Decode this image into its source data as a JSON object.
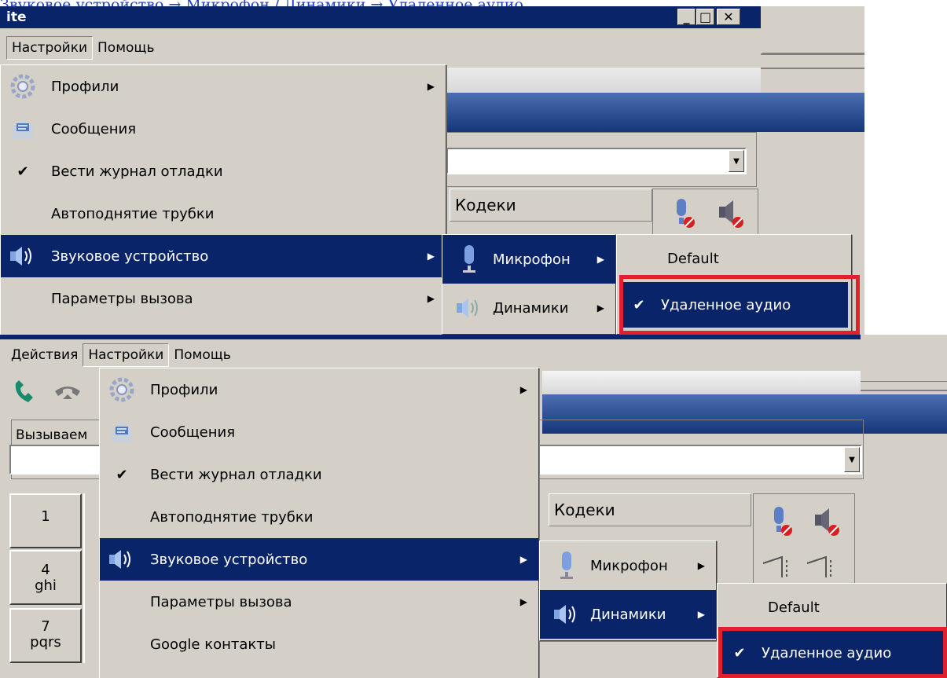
{
  "caption": "Звуковое устройство → Микрофон / Динамики → Удаленное аудио",
  "window": {
    "title": "ite",
    "buttons": [
      "_",
      "□",
      "✕"
    ]
  },
  "menubar_top": [
    "Настройки",
    "Помощь"
  ],
  "menubar_bottom": [
    "Действия",
    "Настройки",
    "Помощь"
  ],
  "settings_menu": {
    "items": [
      {
        "label": "Профили",
        "icon": "gear-icon",
        "submenu": true
      },
      {
        "label": "Сообщения",
        "icon": "message-icon",
        "submenu": false
      },
      {
        "label": "Вести журнал отладки",
        "icon": "check-icon",
        "checked": true
      },
      {
        "label": "Автоподнятие трубки",
        "icon": "",
        "submenu": false
      },
      {
        "label": "Звуковое устройство",
        "icon": "speaker-icon",
        "submenu": true,
        "selected": true
      },
      {
        "label": "Параметры вызова",
        "icon": "",
        "submenu": true
      },
      {
        "label": "Google контакты",
        "icon": "",
        "submenu": false
      }
    ]
  },
  "sound_submenu": {
    "items": [
      {
        "label": "Микрофон",
        "icon": "microphone-icon"
      },
      {
        "label": "Динамики",
        "icon": "speaker-icon"
      }
    ]
  },
  "device_submenu": {
    "items": [
      {
        "label": "Default"
      },
      {
        "label": "Удаленное аудио",
        "checked": true
      }
    ]
  },
  "codecs_header": "Кодеки",
  "called_label": "Вызываем",
  "keypad": [
    {
      "digit": "1",
      "letters": ""
    },
    {
      "digit": "4",
      "letters": "ghi"
    },
    {
      "digit": "7",
      "letters": "pqrs"
    }
  ],
  "colors": {
    "menu_bg": "#d4d0c8",
    "highlight": "#0a246a",
    "red_frame": "#e0202c"
  }
}
